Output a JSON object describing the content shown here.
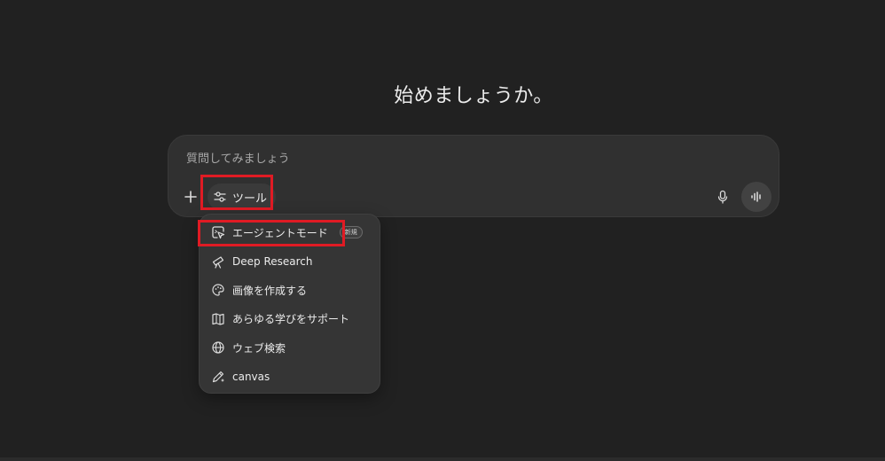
{
  "headline": "始めましょうか。",
  "composer": {
    "placeholder": "質問してみましょう",
    "tools_label": "ツール"
  },
  "tools_menu": {
    "items": [
      {
        "label": "エージェントモード",
        "icon": "agent-cursor-icon",
        "badge": "新規"
      },
      {
        "label": "Deep Research",
        "icon": "telescope-icon"
      },
      {
        "label": "画像を作成する",
        "icon": "palette-icon"
      },
      {
        "label": "あらゆる学びをサポート",
        "icon": "book-icon"
      },
      {
        "label": "ウェブ検索",
        "icon": "globe-icon"
      },
      {
        "label": "canvas",
        "icon": "pen-icon"
      }
    ]
  },
  "colors": {
    "background": "#212121",
    "composer": "#303030",
    "menu": "#353535",
    "highlight": "#e01b24",
    "text": "#ececec"
  }
}
